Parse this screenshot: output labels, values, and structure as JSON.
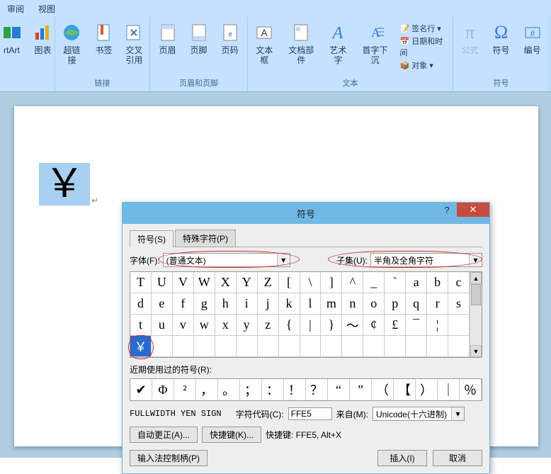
{
  "menu": {
    "review": "审阅",
    "view": "视图"
  },
  "ribbon": {
    "groups": {
      "illus": {
        "smartart": "rtArt",
        "chart": "图表"
      },
      "links": {
        "hyperlink": "超链接",
        "bookmark": "书签",
        "crossref": "交叉\n引用",
        "label": "链接"
      },
      "hf": {
        "header": "页眉",
        "footer": "页脚",
        "pagenum": "页码",
        "label": "页眉和页脚"
      },
      "text": {
        "textbox": "文本框",
        "quickparts": "文档部件",
        "wordart": "艺术字",
        "dropcap": "首字下沉",
        "sig": "签名行",
        "datetime": "日期和时间",
        "obj": "对象",
        "label": "文本"
      },
      "symbols": {
        "equation": "公式",
        "symbol": "符号",
        "number": "编号",
        "label": "符号"
      }
    }
  },
  "page": {
    "glyph": "￥"
  },
  "dialog": {
    "title": "符号",
    "tabs": {
      "symbols": "符号(S)",
      "special": "特殊字符(P)"
    },
    "font_label": "字体(F):",
    "font_value": "(普通文本)",
    "subset_label": "子集(U):",
    "subset_value": "半角及全角字符",
    "grid": [
      "T",
      "U",
      "V",
      "W",
      "X",
      "Y",
      "Z",
      "[",
      "\\",
      "]",
      "^",
      "_",
      "`",
      "a",
      "b",
      "c",
      "d",
      "e",
      "f",
      "g",
      "h",
      "i",
      "j",
      "k",
      "l",
      "m",
      "n",
      "o",
      "p",
      "q",
      "r",
      "s",
      "t",
      "u",
      "v",
      "w",
      "x",
      "y",
      "z",
      "{",
      "|",
      "}",
      "～",
      "¢",
      "£",
      "¯",
      "¦",
      "",
      "￥",
      "",
      "",
      "",
      "",
      "",
      "",
      "",
      "",
      "",
      "",
      "",
      "",
      "",
      "",
      ""
    ],
    "selected_index": 48,
    "recent_label": "近期使用过的符号(R):",
    "recent": [
      "✔",
      "Φ",
      "²",
      "，",
      "。",
      "；",
      "：",
      "！",
      "？",
      "“",
      "”",
      "（",
      "【",
      "）",
      "｜",
      "％"
    ],
    "charname": "FULLWIDTH YEN SIGN",
    "code_label": "字符代码(C):",
    "code_value": "FFE5",
    "from_label": "来自(M):",
    "from_value": "Unicode(十六进制)",
    "autocorrect": "自动更正(A)...",
    "shortcutkey_btn": "快捷键(K)...",
    "shortcut_text": "快捷键: FFE5, Alt+X",
    "ime_btn": "输入法控制柄(P)",
    "insert_btn": "插入(I)",
    "cancel_btn": "取消"
  }
}
